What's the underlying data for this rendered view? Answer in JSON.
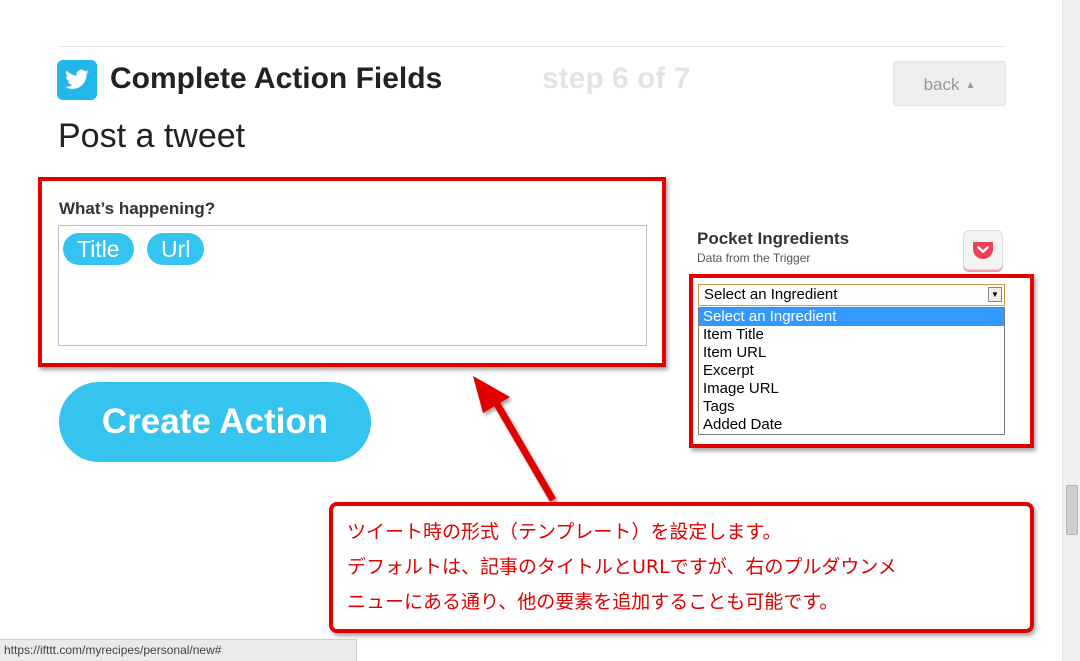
{
  "header": {
    "title": "Complete Action Fields",
    "step": "step 6 of 7",
    "back_label": "back",
    "back_caret": "▲"
  },
  "action": {
    "name": "Post a tweet"
  },
  "field": {
    "label": "What’s happening?",
    "ingredients": [
      "Title",
      "Url"
    ]
  },
  "create_button": "Create Action",
  "ingredients_panel": {
    "title": "Pocket Ingredients",
    "subtitle": "Data from the Trigger",
    "select_value": "Select an Ingredient",
    "options": [
      "Select an Ingredient",
      "Item Title",
      "Item URL",
      "Excerpt",
      "Image URL",
      "Tags",
      "Added Date"
    ],
    "selected_index": 0
  },
  "annotation": {
    "lines": [
      "ツイート時の形式（テンプレート）を設定します。",
      "デフォルトは、記事のタイトルとURLですが、右のプルダウンメ",
      "ニューにある通り、他の要素を追加することも可能です。"
    ]
  },
  "status_bar": {
    "url": "https://ifttt.com/myrecipes/personal/new#"
  },
  "colors": {
    "accent": "#35c3ef",
    "twitter": "#22b7e8",
    "highlight": "#e00000",
    "pocket": "#ee4056"
  }
}
